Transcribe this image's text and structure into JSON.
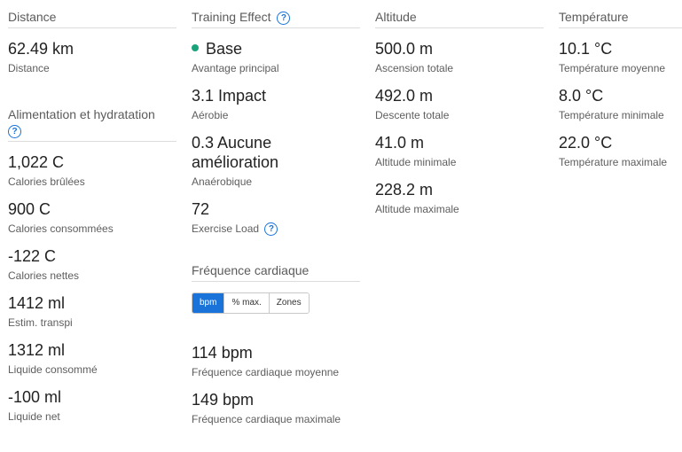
{
  "distance": {
    "header": "Distance",
    "value": "62.49 km",
    "label": "Distance"
  },
  "nutrition": {
    "header": "Alimentation et hydratation",
    "items": [
      {
        "value": "1,022 C",
        "label": "Calories brûlées"
      },
      {
        "value": "900 C",
        "label": "Calories consommées"
      },
      {
        "value": "-122 C",
        "label": "Calories nettes"
      },
      {
        "value": "1412 ml",
        "label": "Estim. transpi"
      },
      {
        "value": "1312 ml",
        "label": "Liquide consommé"
      },
      {
        "value": "-100 ml",
        "label": "Liquide net"
      }
    ]
  },
  "training_effect": {
    "header": "Training Effect",
    "primary": {
      "value": "Base",
      "label": "Avantage principal",
      "dot_color": "#1aa37a"
    },
    "aerobic": {
      "value": "3.1 Impact",
      "label": "Aérobie"
    },
    "anaerobic": {
      "value": "0.3 Aucune amélioration",
      "label": "Anaérobique"
    },
    "exercise_load": {
      "value": "72",
      "label": "Exercise Load"
    }
  },
  "heart_rate": {
    "header": "Fréquence cardiaque",
    "toggle": [
      "bpm",
      "% max.",
      "Zones"
    ],
    "active_toggle": "bpm",
    "items": [
      {
        "value": "114 bpm",
        "label": "Fréquence cardiaque moyenne"
      },
      {
        "value": "149 bpm",
        "label": "Fréquence cardiaque maximale"
      }
    ]
  },
  "altitude": {
    "header": "Altitude",
    "items": [
      {
        "value": "500.0 m",
        "label": "Ascension totale"
      },
      {
        "value": "492.0 m",
        "label": "Descente totale"
      },
      {
        "value": "41.0 m",
        "label": "Altitude minimale"
      },
      {
        "value": "228.2 m",
        "label": "Altitude maximale"
      }
    ]
  },
  "temperature": {
    "header": "Température",
    "items": [
      {
        "value": "10.1 °C",
        "label": "Température moyenne"
      },
      {
        "value": "8.0 °C",
        "label": "Température minimale"
      },
      {
        "value": "22.0 °C",
        "label": "Température maximale"
      }
    ]
  },
  "icons": {
    "help": "question-circle-icon",
    "help_glyph": "?"
  },
  "colors": {
    "accent": "#1a73d9",
    "dot": "#1aa37a"
  }
}
